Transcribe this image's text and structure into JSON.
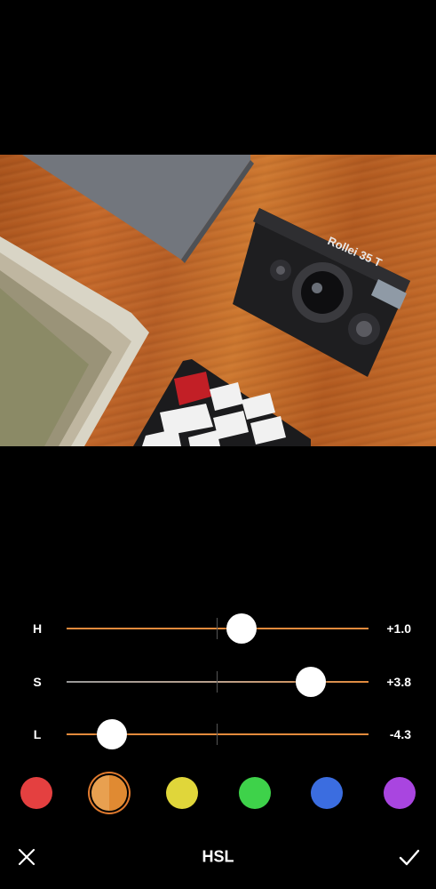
{
  "photo": {
    "camera_brand": "Rollei 35 T"
  },
  "sliders": [
    {
      "label": "H",
      "value_text": "+1.0",
      "position": 0.58
    },
    {
      "label": "S",
      "value_text": "+3.8",
      "position": 0.81
    },
    {
      "label": "L",
      "value_text": "-4.3",
      "position": 0.15
    }
  ],
  "swatches": [
    {
      "name": "red",
      "color": "#e44040"
    },
    {
      "name": "orange",
      "color": "#e08a32",
      "selected": true
    },
    {
      "name": "yellow",
      "color": "#e0d63a"
    },
    {
      "name": "green",
      "color": "#3ed24a"
    },
    {
      "name": "blue",
      "color": "#3b6de0"
    },
    {
      "name": "purple",
      "color": "#a945e0"
    }
  ],
  "bottom_bar": {
    "title": "HSL",
    "close_icon": "close-icon",
    "confirm_icon": "checkmark-icon"
  },
  "colors": {
    "track_gradient_start": "#999999",
    "track_gradient_end": "#e28a3c",
    "accent": "#e07a2e"
  }
}
